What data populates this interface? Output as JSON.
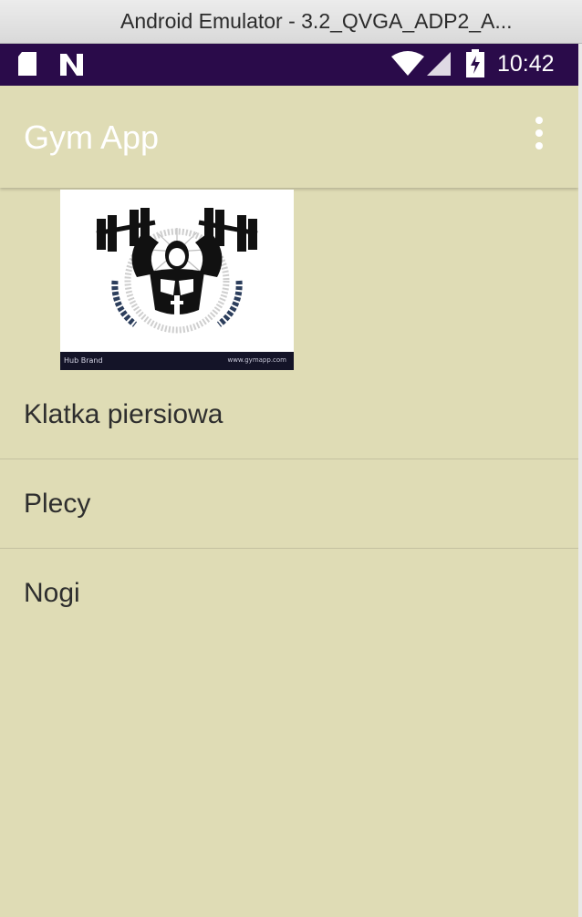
{
  "window": {
    "title": "Android Emulator - 3.2_QVGA_ADP2_A..."
  },
  "status_bar": {
    "time": "10:42",
    "icons": [
      "sd-card-icon",
      "n-notification-icon",
      "wifi-icon",
      "cell-signal-icon",
      "battery-charging-icon"
    ],
    "background_color": "#2a0b4a"
  },
  "app_bar": {
    "title": "Gym App",
    "menu_icon": "overflow-menu-icon"
  },
  "logo": {
    "icon": "bodybuilder-barbell-emblem",
    "caption_left": "Hub Brand",
    "caption_right": "www.gymapp.com"
  },
  "menu": {
    "items": [
      {
        "label": "Klatka piersiowa"
      },
      {
        "label": "Plecy"
      },
      {
        "label": "Nogi"
      }
    ]
  },
  "colors": {
    "background": "#dfdcb5",
    "text": "#2e2e2e",
    "divider": "#c4c1a0"
  }
}
